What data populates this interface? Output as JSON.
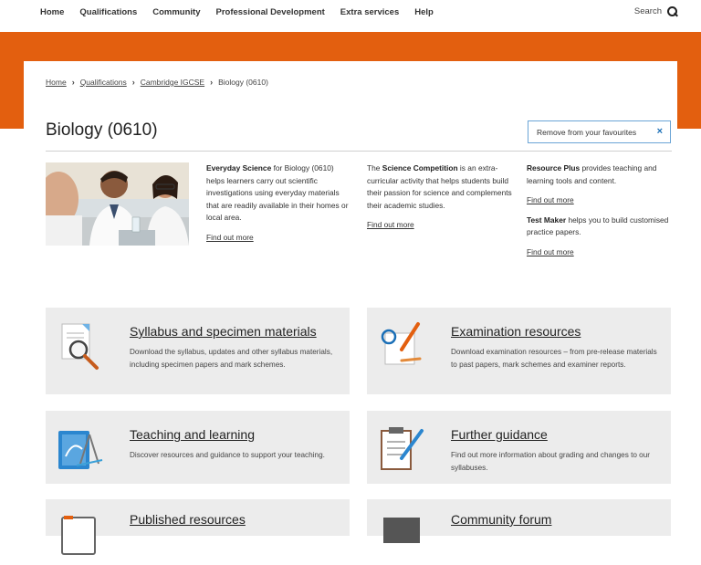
{
  "nav": {
    "items": [
      "Home",
      "Qualifications",
      "Community",
      "Professional Development",
      "Extra services",
      "Help"
    ],
    "search_label": "Search"
  },
  "breadcrumb": [
    "Home",
    "Qualifications",
    "Cambridge IGCSE",
    "Biology (0610)"
  ],
  "page": {
    "title": "Biology (0610)",
    "favourite_button": "Remove from your favourites",
    "favourite_close": "×"
  },
  "promos": {
    "everyday": {
      "bold": "Everyday Science",
      "text": " for Biology (0610) helps learners carry out scientific investigations using everyday materials that are readily available in their homes or local area.",
      "link": "Find out more"
    },
    "competition": {
      "lead": "The ",
      "bold": "Science Competition",
      "text": " is an extra-curricular activity that helps students build their passion for science and complements their academic studies.",
      "link": "Find out more"
    },
    "resource_plus": {
      "bold": "Resource Plus",
      "text": " provides teaching and learning tools and content.",
      "link": "Find out more"
    },
    "test_maker": {
      "bold": "Test Maker",
      "text": " helps you to build customised practice papers.",
      "link": "Find out more"
    }
  },
  "tiles": [
    {
      "title": "Syllabus and specimen materials",
      "desc": "Download the syllabus, updates and other syllabus materials, including specimen papers and mark schemes.",
      "icon": "magnifier-document-icon"
    },
    {
      "title": "Examination resources",
      "desc": "Download examination resources – from pre-release materials to past papers, mark schemes and examiner reports.",
      "icon": "pencil-paper-icon"
    },
    {
      "title": "Teaching and learning",
      "desc": "Discover resources and guidance to support your teaching.",
      "icon": "folder-compass-icon"
    },
    {
      "title": "Further guidance",
      "desc": "Find out more information about grading and changes to our syllabuses.",
      "icon": "clipboard-pen-icon"
    },
    {
      "title": "Published resources",
      "desc": "",
      "icon": "book-icon"
    },
    {
      "title": "Community forum",
      "desc": "",
      "icon": "laptop-icon"
    }
  ],
  "colors": {
    "brand_orange": "#e35f0f",
    "tile_bg": "#ececec",
    "accent_blue": "#1a6fb7"
  }
}
